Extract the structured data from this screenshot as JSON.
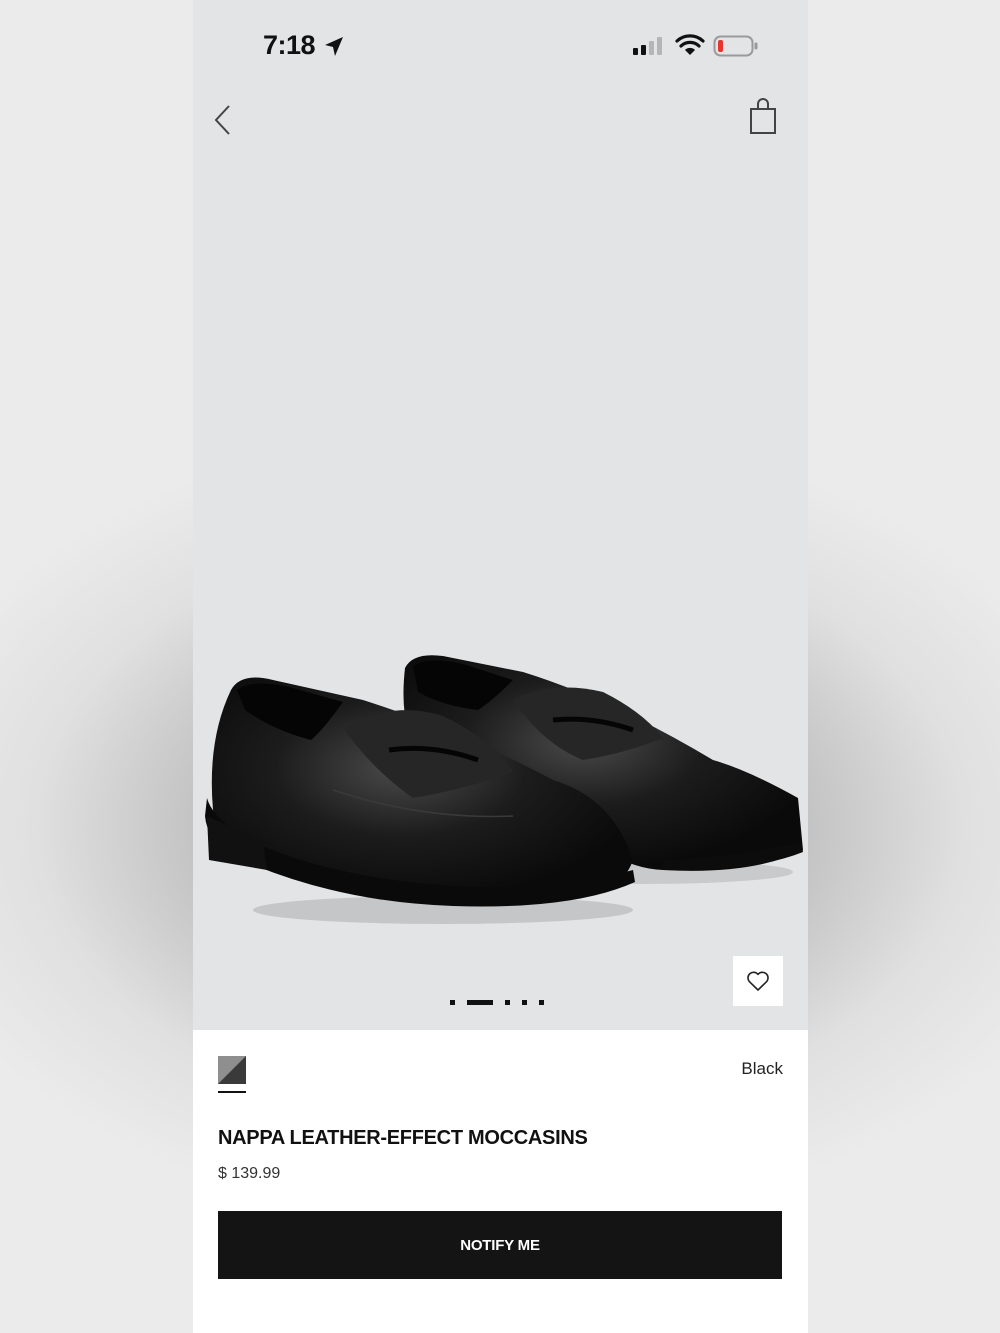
{
  "status_bar": {
    "time": "7:18",
    "icons": [
      "location-arrow-icon",
      "cellular-signal-icon",
      "wifi-icon",
      "battery-low-icon"
    ],
    "battery_color": "#e5372f"
  },
  "nav": {
    "back_icon": "chevron-left-icon",
    "bag_icon": "shopping-bag-icon"
  },
  "gallery": {
    "image": "black-penny-loafers",
    "slide_count": 5,
    "active_slide": 2,
    "wishlist_icon": "heart-icon"
  },
  "product": {
    "color_name": "Black",
    "title": "NAPPA LEATHER-EFFECT MOCCASINS",
    "price": "$ 139.99",
    "cta_label": "NOTIFY ME"
  },
  "colors": {
    "page_background": "#e3e4e6",
    "panel_background": "#ffffff",
    "button_background": "#141414",
    "button_text": "#ffffff"
  }
}
